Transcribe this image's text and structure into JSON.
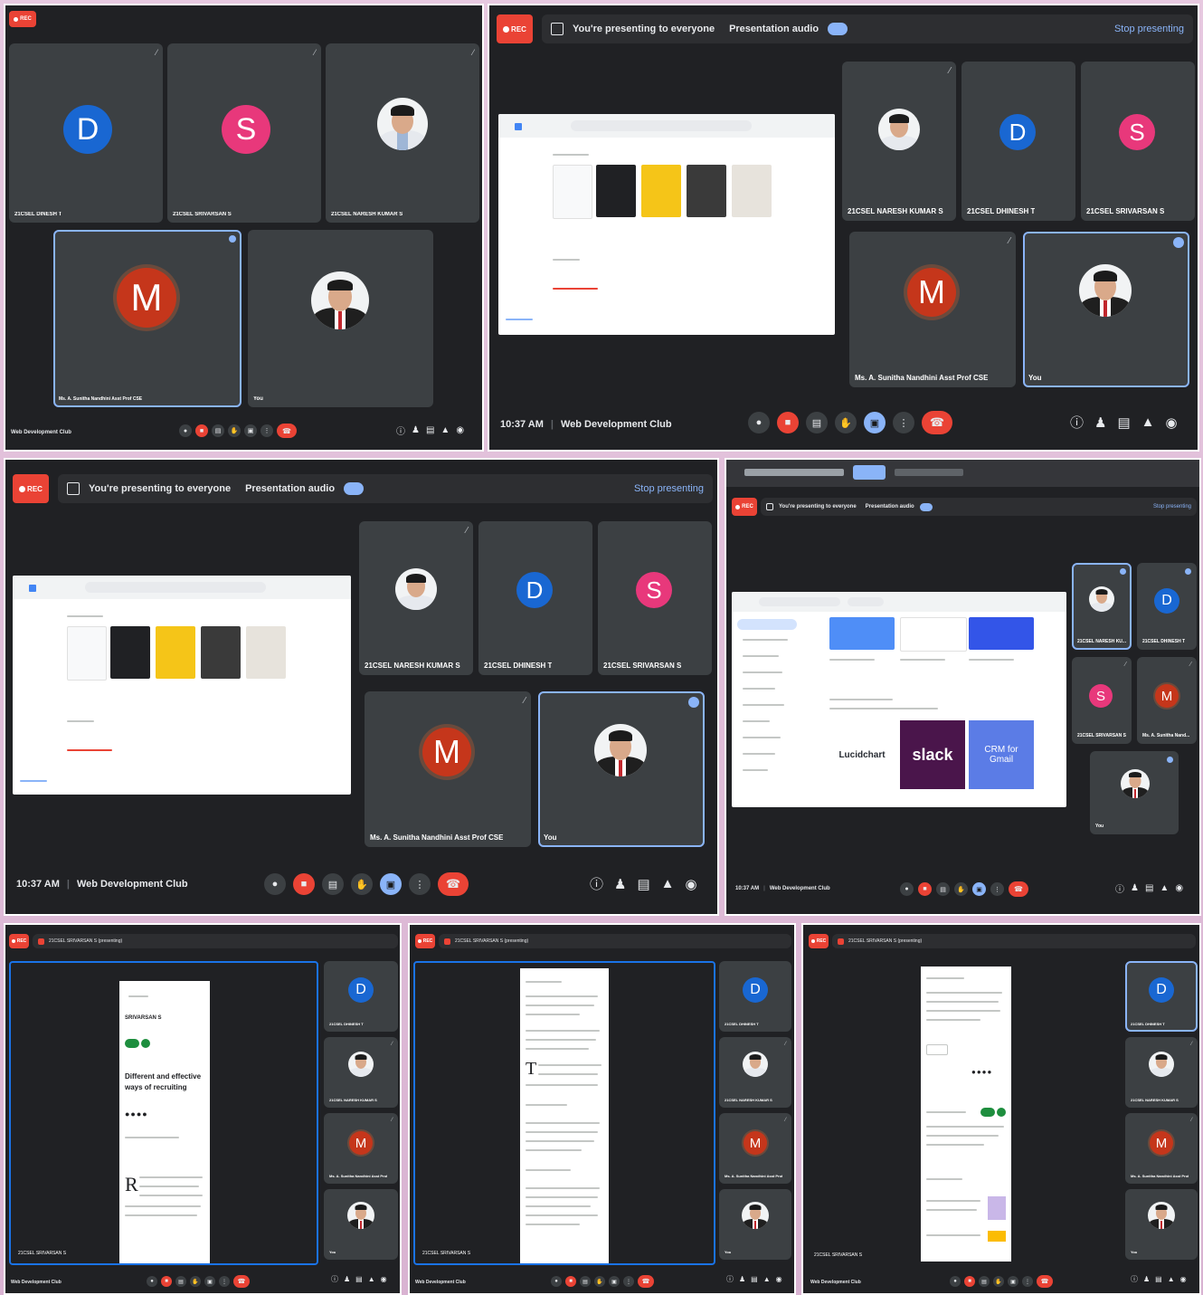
{
  "collage": {
    "panel1": {
      "rec": "REC",
      "tiles": [
        {
          "initial": "D",
          "name": "21CSEL DINESH T"
        },
        {
          "initial": "S",
          "name": "21CSEL SRIVARSAN S"
        },
        {
          "initial": "",
          "name": "21CSEL NARESH KUMAR S"
        },
        {
          "initial": "M",
          "name": "Ms. A. Sunitha Nandhini Asst Prof CSE"
        },
        {
          "initial": "",
          "name": "You"
        }
      ],
      "meeting_name": "Web Development Club"
    },
    "panel2": {
      "rec": "REC",
      "presenting": "You're presenting to everyone",
      "audio": "Presentation audio",
      "stop": "Stop presenting",
      "tiles": [
        {
          "initial": "",
          "name": "21CSEL NARESH KUMAR S"
        },
        {
          "initial": "D",
          "name": "21CSEL DHINESH T"
        },
        {
          "initial": "S",
          "name": "21CSEL SRIVARSAN S"
        },
        {
          "initial": "M",
          "name": "Ms. A. Sunitha Nandhini Asst Prof CSE"
        },
        {
          "initial": "",
          "name": "You"
        }
      ],
      "time": "10:37 AM",
      "meeting_name": "Web Development Club"
    },
    "panel3": {
      "rec": "REC",
      "presenting": "You're presenting to everyone",
      "audio": "Presentation audio",
      "stop": "Stop presenting",
      "tiles": [
        {
          "initial": "",
          "name": "21CSEL NARESH KUMAR S"
        },
        {
          "initial": "D",
          "name": "21CSEL DHINESH T"
        },
        {
          "initial": "S",
          "name": "21CSEL SRIVARSAN S"
        },
        {
          "initial": "M",
          "name": "Ms. A. Sunitha Nandhini Asst Prof CSE"
        },
        {
          "initial": "",
          "name": "You"
        }
      ],
      "time": "10:37 AM",
      "meeting_name": "Web Development Club"
    },
    "panel4": {
      "rec": "REC",
      "presenting": "You're presenting to everyone",
      "audio": "Presentation audio",
      "stop": "Stop presenting",
      "apps": [
        "Lucidchart",
        "slack",
        "CRM for Gmail"
      ],
      "tiles": [
        {
          "initial": "",
          "name": "21CSEL NARESH KU..."
        },
        {
          "initial": "D",
          "name": "21CSEL DHINESH T"
        },
        {
          "initial": "S",
          "name": "21CSEL SRIVARSAN S"
        },
        {
          "initial": "M",
          "name": "Ms. A. Sunitha Nand..."
        },
        {
          "initial": "",
          "name": "You"
        }
      ],
      "time": "10:37 AM",
      "meeting_name": "Web Development Club"
    },
    "panel5": {
      "rec": "REC",
      "presenting": "21CSEL SRIVARSAN S (presenting)",
      "doc_author": "SRIVARSAN S",
      "doc_title": "Different and effective ways of recruiting",
      "tiles": [
        {
          "initial": "D",
          "name": "21CSEL DHINESH T"
        },
        {
          "initial": "",
          "name": "21CSEL NARESH KUMAR S"
        },
        {
          "initial": "M",
          "name": "Ms. A. Sunitha Nandhini Asst Prof"
        },
        {
          "initial": "",
          "name": "You"
        }
      ],
      "presenter_label": "21CSEL SRIVARSAN S",
      "meeting_name": "Web Development Club"
    },
    "panel6": {
      "rec": "REC",
      "presenting": "21CSEL SRIVARSAN S (presenting)",
      "tiles": [
        {
          "initial": "D",
          "name": "21CSEL DHINESH T"
        },
        {
          "initial": "",
          "name": "21CSEL NARESH KUMAR S"
        },
        {
          "initial": "M",
          "name": "Ms. A. Sunitha Nandhini Asst Prof"
        },
        {
          "initial": "",
          "name": "You"
        }
      ],
      "presenter_label": "21CSEL SRIVARSAN S",
      "meeting_name": "Web Development Club"
    },
    "panel7": {
      "rec": "REC",
      "presenting": "21CSEL SRIVARSAN S (presenting)",
      "tiles": [
        {
          "initial": "D",
          "name": "21CSEL DHINESH T"
        },
        {
          "initial": "",
          "name": "21CSEL NARESH KUMAR S"
        },
        {
          "initial": "M",
          "name": "Ms. A. Sunitha Nandhini Asst Prof"
        },
        {
          "initial": "",
          "name": "You"
        }
      ],
      "presenter_label": "21CSEL SRIVARSAN S",
      "meeting_name": "Web Development Club"
    }
  },
  "icons": {
    "mic": "mic-icon",
    "camera": "camera-icon",
    "captions": "captions-icon",
    "hand": "raise-hand-icon",
    "present": "present-icon",
    "more": "more-options-icon",
    "end": "end-call-icon",
    "info": "info-icon",
    "people": "people-icon",
    "chat": "chat-icon",
    "activities": "activities-icon",
    "host": "host-controls-icon"
  },
  "colors": {
    "background": "#202124",
    "tile": "#3c4043",
    "red": "#ea4335",
    "blue": "#8ab4f8",
    "avatar_d": "#1967d2",
    "avatar_s": "#e8387b",
    "avatar_m": "#c5361b"
  }
}
